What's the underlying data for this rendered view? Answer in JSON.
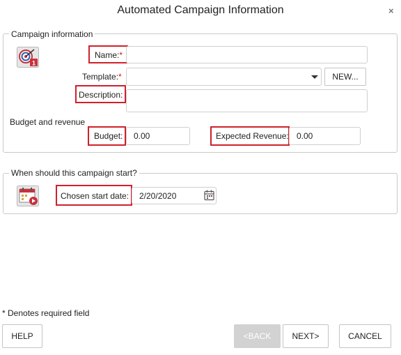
{
  "dialog": {
    "title": "Automated Campaign Information",
    "close_glyph": "×"
  },
  "campaign_info": {
    "legend": "Campaign information",
    "icon": "target-campaign-icon",
    "name_label": "Name:",
    "name_value": "",
    "template_label": "Template:",
    "template_value": "",
    "required_marker": "*",
    "new_button": "NEW...",
    "description_label": "Description:",
    "description_value": ""
  },
  "budget": {
    "heading": "Budget and revenue",
    "budget_label": "Budget:",
    "budget_value": "0.00",
    "revenue_label": "Expected Revenue:",
    "revenue_value": "0.00"
  },
  "start": {
    "legend": "When should this campaign start?",
    "icon": "calendar-start-icon",
    "date_label": "Chosen start date:",
    "date_value": "2/20/2020",
    "date_picker_icon": "calendar-icon"
  },
  "footer": {
    "required_note": "* Denotes required field",
    "help_button": "HELP",
    "back_button": "<BACK",
    "next_button": "NEXT>",
    "cancel_button": "CANCEL"
  },
  "colors": {
    "highlight": "#d0202a",
    "required": "#d01818",
    "disabled_button": "#d2d2d2"
  }
}
